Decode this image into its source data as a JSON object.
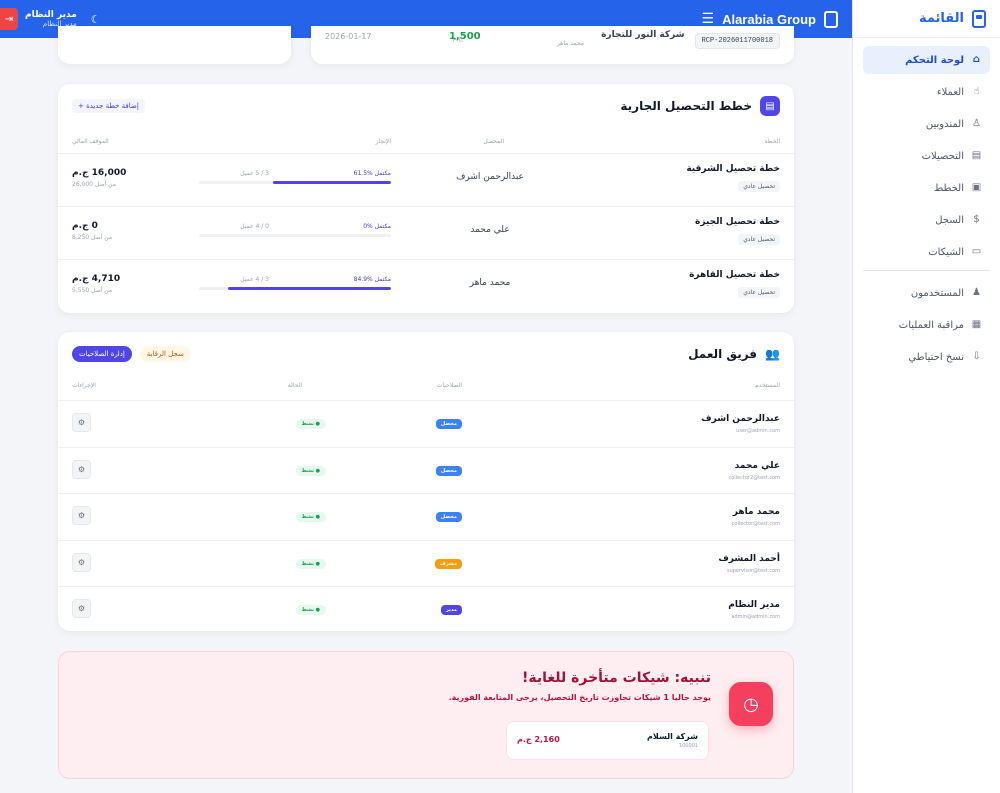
{
  "topbar": {
    "brand": "Alarabia Group",
    "menu_icon": "hamburger-icon",
    "user_name": "مدير النظام",
    "user_role": "مدير النظام"
  },
  "sidebar": {
    "title": "القائمة",
    "items": [
      {
        "label": "لوحة التحكم",
        "icon": "⌂",
        "active": true
      },
      {
        "label": "العملاء",
        "icon": "☝"
      },
      {
        "label": "المندوبين",
        "icon": "♙"
      },
      {
        "label": "التحصيلات",
        "icon": "▤"
      },
      {
        "label": "الخطط",
        "icon": "▣"
      },
      {
        "label": "السجل",
        "icon": "$"
      },
      {
        "label": "الشيكات",
        "icon": "▭"
      }
    ],
    "admin_items": [
      {
        "label": "المستخدمون",
        "icon": "♟"
      },
      {
        "label": "مراقبة العمليات",
        "icon": "▦"
      },
      {
        "label": "نسخ احتياطي",
        "icon": "⇩"
      }
    ]
  },
  "receipt": {
    "code": "RCP-2026011700018",
    "company": "شركة النور للتجارة",
    "collector": "محمد ماهر",
    "amount": "1,500",
    "currency": "ج.م",
    "date": "2026-01-17"
  },
  "plans": {
    "title": "خطط التحصيل الجارية",
    "add_label": "إضافة خطة جديدة +",
    "headers": {
      "plan": "الخطة",
      "collector": "المحصل",
      "progress": "الإنجاز",
      "financial": "الموقف المالي"
    },
    "rows": [
      {
        "name": "خطة تحصيل الشرقية",
        "type": "تحصيل عادي",
        "collector": "عبدالرحمن اشرف",
        "pct_label": "61.5% مكتمل",
        "count": "3 / 5 عميل",
        "pct": 0.615,
        "amount": "16,000 ج.م",
        "of": "من أصل 26,000"
      },
      {
        "name": "خطة تحصيل الجيزة",
        "type": "تحصيل عادي",
        "collector": "علي محمد",
        "pct_label": "0% مكتمل",
        "count": "0 / 4 عميل",
        "pct": 0.0,
        "amount": "0 ج.م",
        "of": "من أصل 8,250"
      },
      {
        "name": "خطة تحصيل القاهرة",
        "type": "تحصيل عادي",
        "collector": "محمد ماهر",
        "pct_label": "84.9% مكتمل",
        "count": "3 / 4 عميل",
        "pct": 0.849,
        "amount": "4,710 ج.م",
        "of": "من أصل 5,550"
      }
    ]
  },
  "team": {
    "title": "فريق العمل",
    "audit_label": "سجل الرقابة",
    "perm_label": "إدارة الصلاحيات",
    "headers": {
      "user": "المستخدم",
      "perms": "الصلاحيات",
      "status": "الحالة",
      "actions": "الإجراءات"
    },
    "rows": [
      {
        "name": "عبدالرحمن اشرف",
        "email": "user@admin.com",
        "role": "محصل",
        "role_color": "#3b82f6",
        "status": "● نشط"
      },
      {
        "name": "علي محمد",
        "email": "collector2@test.com",
        "role": "محصل",
        "role_color": "#3b82f6",
        "status": "● نشط"
      },
      {
        "name": "محمد ماهر",
        "email": "collector@test.com",
        "role": "محصل",
        "role_color": "#3b82f6",
        "status": "● نشط"
      },
      {
        "name": "أحمد المشرف",
        "email": "supervisor@test.com",
        "role": "مشرف",
        "role_color": "#f59e0b",
        "status": "● نشط"
      },
      {
        "name": "مدير النظام",
        "email": "admin@admin.com",
        "role": "مدير",
        "role_color": "#4f46e5",
        "status": "● نشط"
      }
    ]
  },
  "alert": {
    "title": "تنبيه: شيكات متأخرة للغاية!",
    "text": "يوجد حاليا 1 شيكات تجاوزت تاريخ التحصيل، يرجى المتابعة الفورية.",
    "check_name": "شركة السلام",
    "check_no": "100001",
    "check_amount": "2,160 ج.م"
  }
}
